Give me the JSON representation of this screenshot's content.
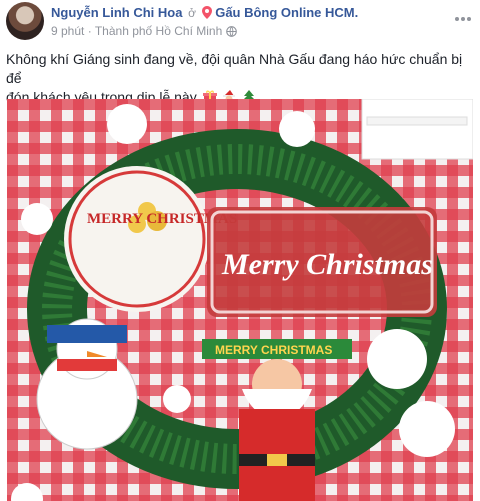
{
  "post": {
    "author": "Nguyễn Linh Chi Hoa",
    "at_text": "ở",
    "page_name": "Gấu Bông Online HCM.",
    "time": "9 phút",
    "location_sep": "·",
    "location": "Thành phố Hồ Chí Minh",
    "text_line1": "Không khí Giáng sinh đang về, đội quân Nhà Gấu đang háo hức chuẩn bị để",
    "text_line2": "đón khách yêu trong dịp lễ này",
    "emojis": [
      "gift-icon",
      "santa-icon",
      "christmas-tree-icon"
    ]
  },
  "photo": {
    "sign_merry_christmas_round": "MERRY CHRISTMAS",
    "sign_merry_christmas_script": "Merry Christmas",
    "banner_text": "MERRY CHRISTMAS"
  },
  "colors": {
    "link": "#365899",
    "meta": "#90949c",
    "text": "#1d2129",
    "tablecloth_red": "#d2263a",
    "garland_green": "#1f5a2a"
  }
}
